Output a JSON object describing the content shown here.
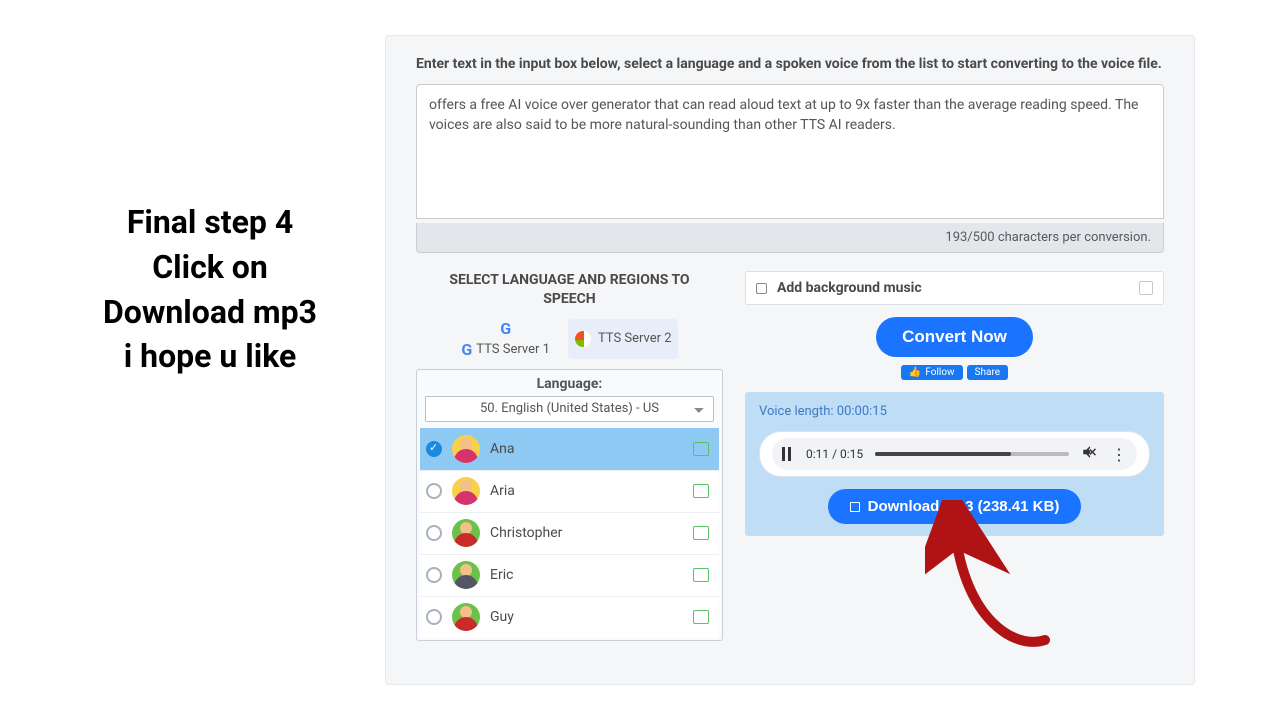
{
  "caption": {
    "line1": "Final step 4",
    "line2": "Click on",
    "line3": "Download mp3",
    "line4": "i hope u like"
  },
  "instruction": "Enter text in the input box below, select a language and a spoken voice from the list to start converting to the voice file.",
  "input_text": "offers a free AI voice over generator that can read aloud text at up to 9x faster than the average reading speed. The voices are also said to be more natural-sounding than other TTS AI readers.",
  "char_counter": "193/500 characters per conversion.",
  "left_column": {
    "title_line1": "SELECT LANGUAGE AND REGIONS TO",
    "title_line2": "SPEECH",
    "server1": "TTS Server 1",
    "server2": "TTS Server 2",
    "language_label": "Language:",
    "language_selected": "50. English (United States) - US",
    "voices": [
      {
        "name": "Ana",
        "selected": true,
        "avatar_bg": "#f9d04b",
        "body": "#d6336c"
      },
      {
        "name": "Aria",
        "selected": false,
        "avatar_bg": "#f9d04b",
        "body": "#d6336c"
      },
      {
        "name": "Christopher",
        "selected": false,
        "avatar_bg": "#6ac24a",
        "body": "#c92a2a"
      },
      {
        "name": "Eric",
        "selected": false,
        "avatar_bg": "#6ac24a",
        "body": "#556"
      },
      {
        "name": "Guy",
        "selected": false,
        "avatar_bg": "#6ac24a",
        "body": "#c92a2a"
      }
    ]
  },
  "right_column": {
    "bg_music_label": "Add background music",
    "convert_label": "Convert Now",
    "follow_label": "Follow",
    "share_label": "Share",
    "voice_length_label": "Voice length: 00:00:15",
    "player_time": "0:11 / 0:15",
    "download_label": "Download Mp3 (238.41 KB)"
  }
}
